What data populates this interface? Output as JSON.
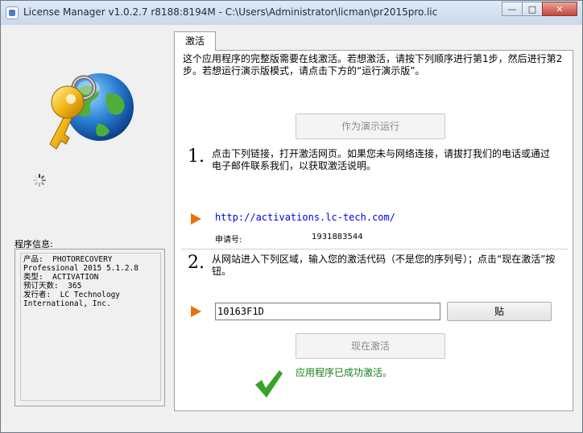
{
  "window": {
    "title": "License Manager v1.0.2.7 r8188:8194M - C:\\Users\\Administrator\\licman\\pr2015pro.lic",
    "minimize_icon": "minimize-icon",
    "maximize_icon": "maximize-icon",
    "close_icon": "close-icon"
  },
  "left_panel": {
    "logo_icon": "key-globe-icon",
    "spinner_icon": "loading-spinner-icon",
    "info_label": "程序信息:",
    "info_text": "产品:  PHOTORECOVERY\nProfessional 2015 5.1.2.8\n类型:  ACTIVATION\n预订天数:  365\n发行者:  LC Technology\nInternational, Inc."
  },
  "tab": {
    "label": "激活"
  },
  "panel": {
    "intro": "这个应用程序的完整版需要在线激活。若想激活，请按下列顺序进行第1步，然后进行第2步。若想运行演示版模式，请点击下方的“运行演示版”。",
    "demo_button": "作为演示运行",
    "step1": {
      "number": "1.",
      "text": "点击下列链接，打开激活网页。如果您未与网络连接，请拔打我们的电话或通过电子邮件联系我们，以获取激活说明。",
      "link": "http://activations.lc-tech.com/",
      "request_label": "申请号:",
      "request_value": "1931883544"
    },
    "step2": {
      "number": "2.",
      "text": "从网站进入下列区域，输入您的激活代码（不是您的序列号）；点击“现在激活”按钮。",
      "code_value": "10163F1D",
      "paste_button": "贴"
    },
    "activate_button": "现在激活",
    "success_message": "应用程序已成功激活。"
  },
  "colors": {
    "arrow": "#e8720c",
    "link": "#0000ee",
    "success": "#108010",
    "check": "#3aa12b"
  }
}
